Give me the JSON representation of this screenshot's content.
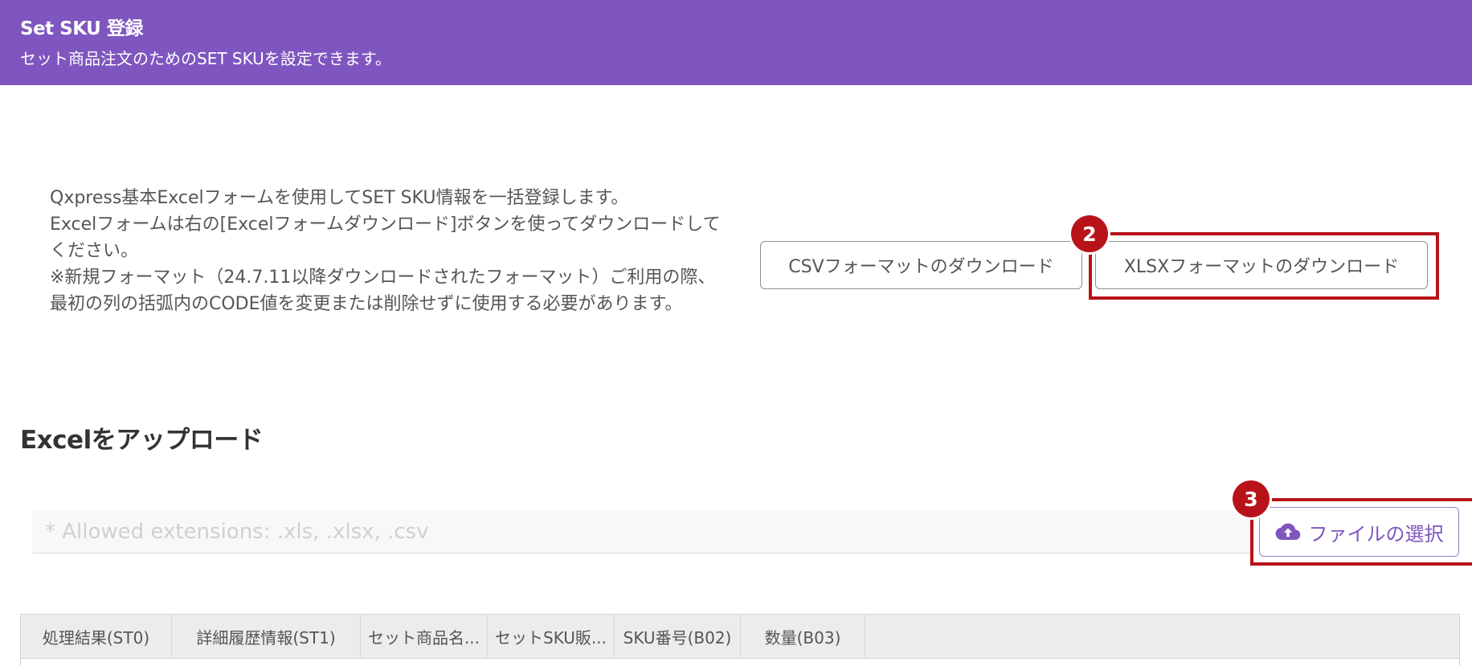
{
  "header": {
    "title": "Set SKU 登録",
    "subtitle": "セット商品注文のためのSET SKUを設定できます。",
    "background_color": "#7f56bf"
  },
  "description": {
    "line1": "Qxpress基本Excelフォームを使用してSET SKU情報を一括登録します。",
    "line2": "Excelフォームは右の[Excelフォームダウンロード]ボタンを使ってダウンロードしてください。",
    "line3": "※新規フォーマット（24.7.11以降ダウンロードされたフォーマット）ご利用の際、最初の列の括弧内のCODE値を変更または削除せずに使用する必要があります。"
  },
  "download_buttons": {
    "csv_label": "CSVフォーマットのダウンロード",
    "xlsx_label": "XLSXフォーマットのダウンロード"
  },
  "markers": {
    "step2": "2",
    "step3": "3",
    "highlight_color": "#b8131a"
  },
  "upload": {
    "section_title": "Excelをアップロード",
    "placeholder": "* Allowed extensions: .xls, .xlsx, .csv",
    "file_button_label": "ファイルの選択",
    "file_button_icon": "cloud-upload-icon"
  },
  "table": {
    "columns": [
      "処理結果(ST0)",
      "詳細履歴情報(ST1)",
      "セット商品名...",
      "セットSKU販...",
      "SKU番号(B02)",
      "数量(B03)"
    ]
  }
}
